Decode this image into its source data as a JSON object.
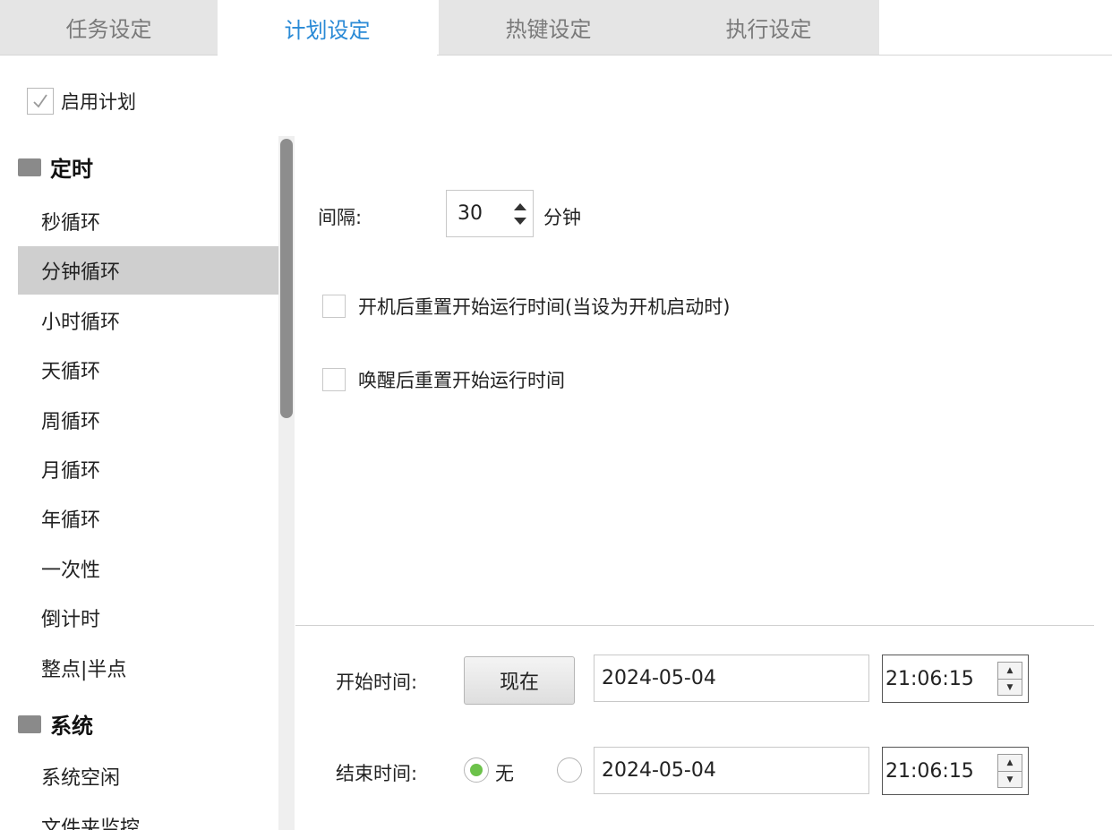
{
  "tabs": [
    {
      "label": "任务设定"
    },
    {
      "label": "计划设定"
    },
    {
      "label": "热键设定"
    },
    {
      "label": "执行设定"
    }
  ],
  "enable_plan": {
    "label": "启用计划",
    "checked": true
  },
  "sidebar": {
    "groups": [
      {
        "label": "定时"
      },
      {
        "label": "系统"
      }
    ],
    "items": [
      {
        "label": "秒循环"
      },
      {
        "label": "分钟循环"
      },
      {
        "label": "小时循环"
      },
      {
        "label": "天循环"
      },
      {
        "label": "周循环"
      },
      {
        "label": "月循环"
      },
      {
        "label": "年循环"
      },
      {
        "label": "一次性"
      },
      {
        "label": "倒计时"
      },
      {
        "label": "整点|半点"
      },
      {
        "label": "系统空闲"
      },
      {
        "label": "文件夹监控"
      }
    ],
    "selected": "分钟循环"
  },
  "interval": {
    "label": "间隔:",
    "value": "30",
    "unit": "分钟"
  },
  "options": {
    "reset_after_boot": {
      "label": "开机后重置开始运行时间(当设为开机启动时)",
      "checked": false
    },
    "reset_after_wake": {
      "label": "唤醒后重置开始运行时间",
      "checked": false
    }
  },
  "start_time": {
    "label": "开始时间:",
    "now_button": "现在",
    "date": "2024-05-04",
    "time": "21:06:15"
  },
  "end_time": {
    "label": "结束时间:",
    "none_label": "无",
    "none_selected": true,
    "date": "2024-05-04",
    "time": "21:06:15"
  },
  "colors": {
    "accent": "#2a8ad6",
    "radio_on": "#6cc24a",
    "selected_bg": "#cfcfcf"
  }
}
